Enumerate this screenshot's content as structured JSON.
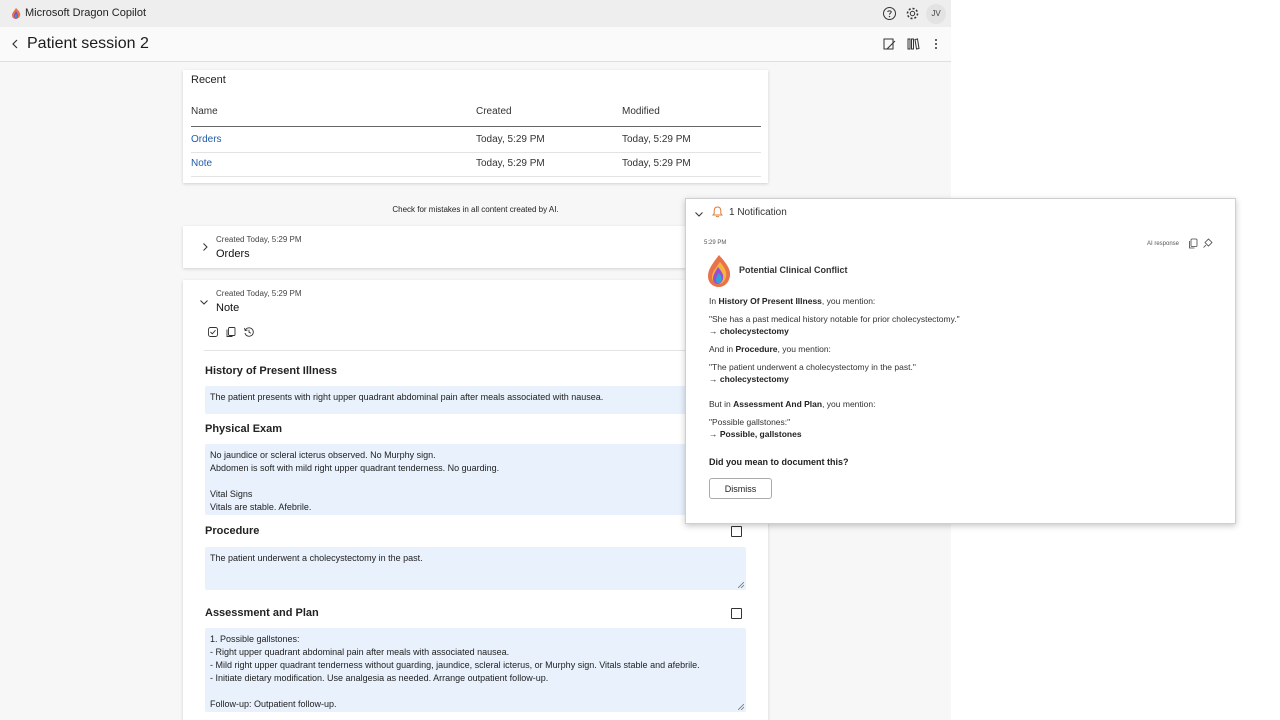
{
  "app": {
    "title": "Microsoft Dragon Copilot",
    "avatar_initials": "JV"
  },
  "header": {
    "title": "Patient session 2"
  },
  "recent": {
    "title": "Recent",
    "columns": [
      "Name",
      "Created",
      "Modified"
    ],
    "rows": [
      {
        "name": "Orders",
        "created": "Today, 5:29 PM",
        "modified": "Today, 5:29 PM"
      },
      {
        "name": "Note",
        "created": "Today, 5:29 PM",
        "modified": "Today, 5:29 PM"
      }
    ]
  },
  "disclaimer": "Check for mistakes in all content created by AI.",
  "orders_card": {
    "created": "Created Today, 5:29 PM",
    "title": "Orders"
  },
  "note_card": {
    "created": "Created Today, 5:29 PM",
    "title": "Note",
    "sections": [
      {
        "title": "History of Present Illness",
        "lines": [
          "The patient presents with right upper quadrant abdominal pain after meals associated with nausea."
        ]
      },
      {
        "title": "Physical Exam",
        "lines": [
          "No jaundice or scleral icterus observed. No Murphy sign.",
          "Abdomen is soft with mild right upper quadrant tenderness. No guarding.",
          "",
          "Vital Signs",
          "Vitals are stable. Afebrile."
        ]
      },
      {
        "title": "Procedure",
        "lines": [
          "The patient underwent a cholecystectomy in the past."
        ]
      },
      {
        "title": "Assessment and Plan",
        "lines": [
          "1. Possible gallstones:",
          "- Right upper quadrant abdominal pain after meals with associated nausea.",
          "- Mild right upper quadrant tenderness without guarding, jaundice, scleral icterus, or Murphy sign. Vitals stable and afebrile.",
          "- Initiate dietary modification. Use analgesia as needed. Arrange outpatient follow-up.",
          "",
          "Follow-up: Outpatient follow-up."
        ]
      }
    ]
  },
  "notification": {
    "header": "1 Notification",
    "time": "5:29 PM",
    "ai_label": "AI response",
    "title": "Potential Clinical Conflict",
    "hpi": {
      "pre": "In ",
      "section": "History Of Present Illness",
      "post": ", you mention:",
      "quote": "\"She has a past medical history notable for prior cholecystectomy.\"",
      "term": "→ cholecystectomy"
    },
    "procedure": {
      "pre": "And in ",
      "section": "Procedure",
      "post": ", you mention:",
      "quote": "\"The patient underwent a cholecystectomy in the past.\"",
      "term": "→ cholecystectomy"
    },
    "assessment": {
      "pre": "But in ",
      "section": "Assessment And Plan",
      "post": ", you mention:",
      "quote": "\"Possible gallstones:\"",
      "term": "→ Possible, gallstones"
    },
    "question": "Did you mean to document this?",
    "dismiss_label": "Dismiss"
  }
}
